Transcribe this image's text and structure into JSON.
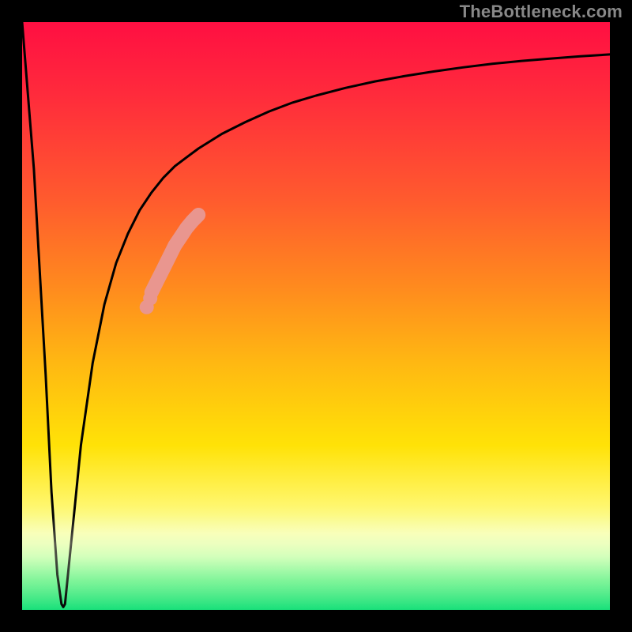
{
  "watermark": "TheBottleneck.com",
  "chart_data": {
    "type": "line",
    "title": "",
    "xlabel": "",
    "ylabel": "",
    "xlim": [
      0,
      100
    ],
    "ylim": [
      0,
      100
    ],
    "grid": false,
    "legend": false,
    "series": [
      {
        "name": "bottleneck-curve",
        "color": "#000000",
        "x": [
          0,
          2,
          4,
          5,
          6,
          6.7,
          7.0,
          7.3,
          8,
          9,
          10,
          12,
          14,
          16,
          18,
          20,
          22,
          24,
          26,
          28,
          30,
          34,
          38,
          42,
          46,
          50,
          55,
          60,
          65,
          70,
          75,
          80,
          85,
          90,
          95,
          100
        ],
        "values": [
          100,
          75,
          40,
          20,
          6,
          1,
          0.5,
          1,
          8,
          18,
          28,
          42,
          52,
          59,
          64,
          68,
          71,
          73.5,
          75.5,
          77,
          78.5,
          81,
          83,
          84.8,
          86.3,
          87.5,
          88.8,
          89.9,
          90.8,
          91.6,
          92.3,
          92.9,
          93.4,
          93.8,
          94.2,
          94.5
        ]
      },
      {
        "name": "highlight-segment",
        "color": "#e9968f",
        "x": [
          22,
          23,
          24,
          25,
          26,
          27,
          28,
          29,
          30
        ],
        "values": [
          54,
          56,
          58,
          60,
          62,
          63.5,
          65,
          66.2,
          67.2
        ]
      },
      {
        "name": "highlight-dot-lower",
        "color": "#e9968f",
        "x": [
          21.2,
          21.8
        ],
        "values": [
          51.5,
          53
        ]
      }
    ],
    "annotations": []
  },
  "colors": {
    "gradient_top": "#ff0f42",
    "gradient_mid1": "#ff8a1e",
    "gradient_mid2": "#ffe207",
    "gradient_bottom": "#18e07a",
    "curve": "#000000",
    "highlight": "#e9968f",
    "frame": "#000000",
    "watermark": "#888888"
  }
}
